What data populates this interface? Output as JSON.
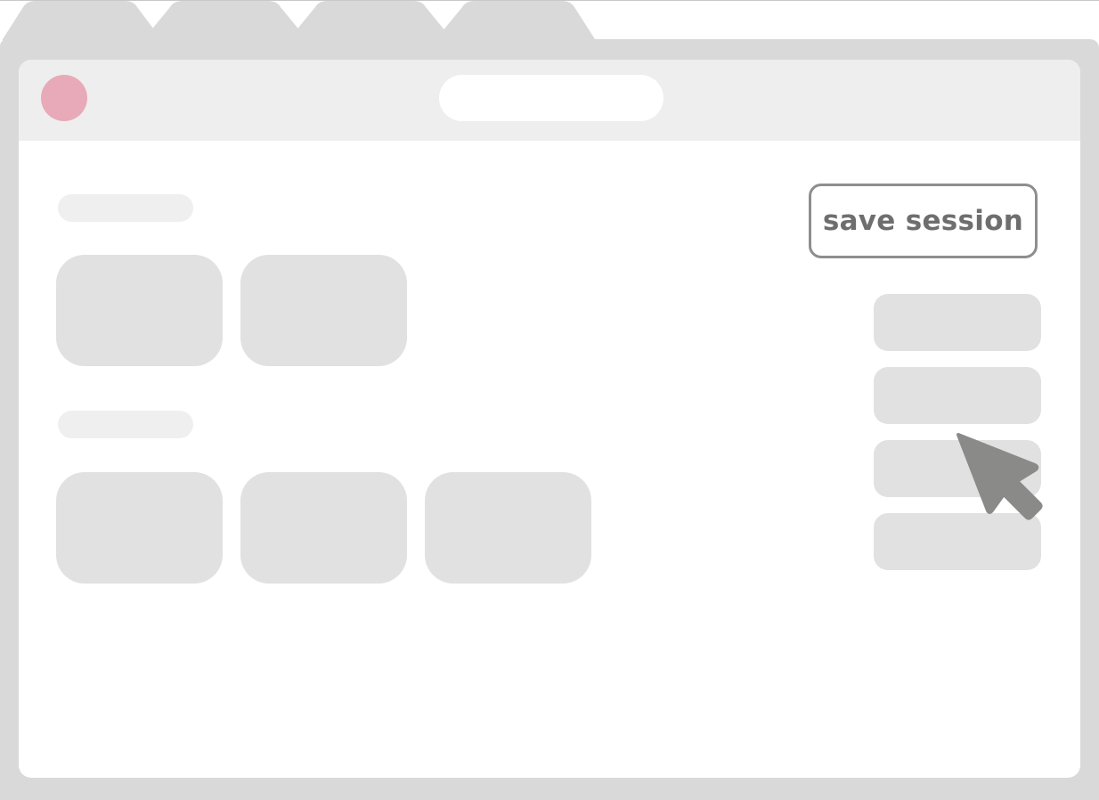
{
  "browser": {
    "tabs": [
      {
        "label": ""
      },
      {
        "label": ""
      },
      {
        "label": ""
      },
      {
        "label": ""
      }
    ],
    "address_bar": {
      "value": ""
    }
  },
  "toolbar": {
    "save_label": "save session"
  },
  "content": {
    "sections": [
      {
        "label": "",
        "card_count": 2
      },
      {
        "label": "",
        "card_count": 3
      }
    ],
    "side_list": {
      "item_count": 4
    }
  },
  "icons": {
    "window_dot": "window-dot-icon",
    "cursor": "mouse-pointer-icon"
  },
  "colors": {
    "frame": "#d9d9d9",
    "toolbar": "#eeeeee",
    "window_dot": "#e8aab8",
    "placeholder": "#e1e1e1",
    "button_border": "#8e8e8e",
    "button_text": "#6e6e6e",
    "cursor": "#8a8a88"
  }
}
